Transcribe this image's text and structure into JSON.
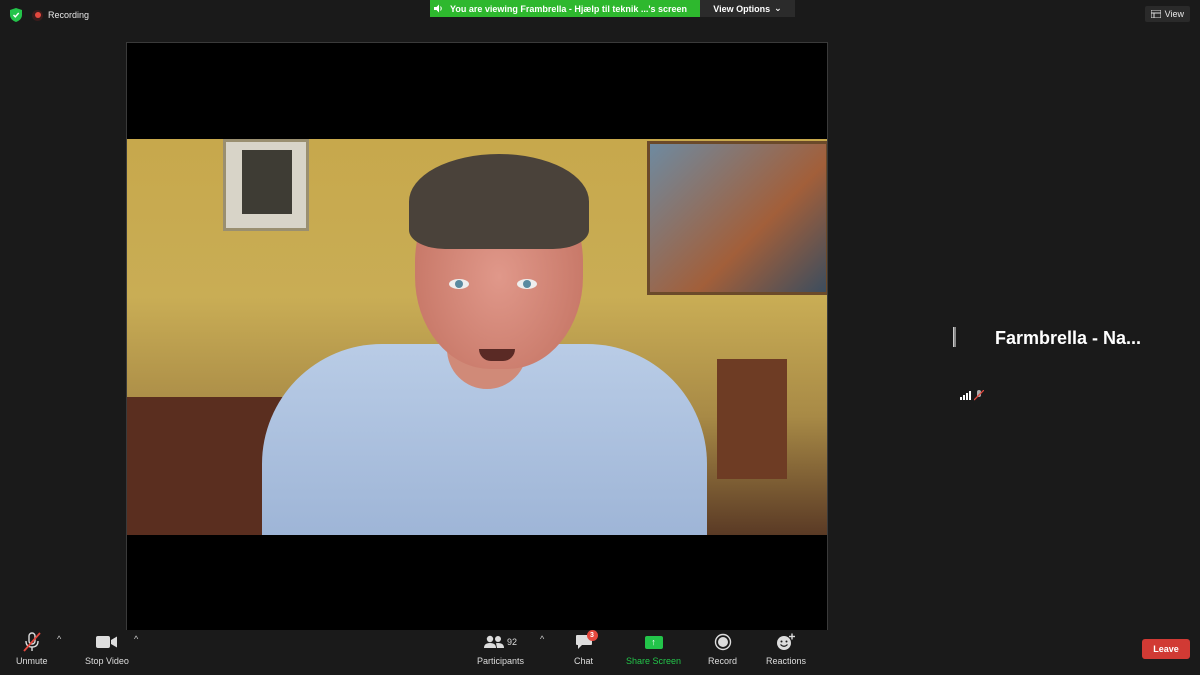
{
  "topbar": {
    "recording_label": "Recording",
    "banner_text": "You are viewing Frambrella - Hjælp til teknik ...'s screen",
    "view_options_label": "View Options",
    "view_label": "View"
  },
  "participant": {
    "name": "Farmbrella  -  Na..."
  },
  "toolbar": {
    "unmute": "Unmute",
    "stop_video": "Stop Video",
    "participants": "Participants",
    "participants_count": "92",
    "chat": "Chat",
    "chat_badge": "3",
    "share_screen": "Share Screen",
    "record": "Record",
    "reactions": "Reactions",
    "leave": "Leave"
  },
  "colors": {
    "banner_green": "#2eb82e",
    "share_green": "#23c44a",
    "leave_red": "#d13a34",
    "recording_red": "#e5483e"
  }
}
